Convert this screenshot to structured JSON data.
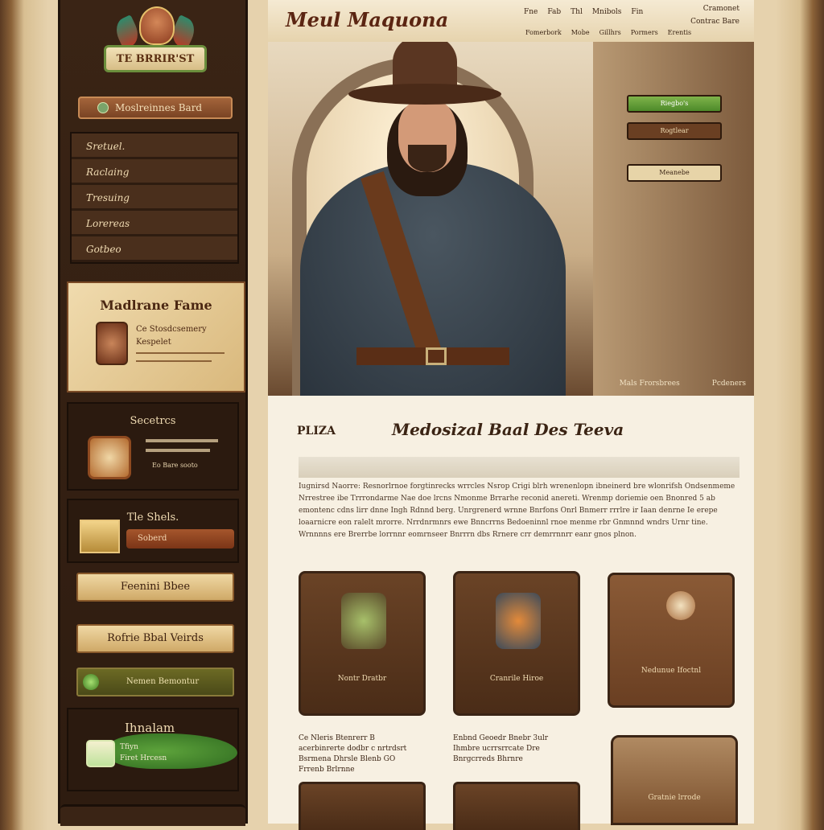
{
  "header": {
    "logo": "Meul Maquona",
    "topnav": [
      "Fne",
      "Fab",
      "Thl",
      "Mnibols",
      "Fin"
    ],
    "account": "Cramonet",
    "account2": "Contrac Bare",
    "secnav": [
      "Fomerbork",
      "Mobe",
      "Gillhrs",
      "Pormers",
      "Erentis"
    ]
  },
  "sidebar": {
    "logo": "TE BRRIR'ST",
    "search_btn": "Moslreinnes Bard",
    "nav": [
      "Sretuel.",
      "Raclaing",
      "Tresuing",
      "Lorereas",
      "Gotbeo"
    ],
    "card_title": "Madlrane Fame",
    "card_line1": "Ce Stosdcsemery",
    "card_line2": "Kespelet",
    "secrets_title": "Secetrcs",
    "secrets_text": "Eo Bare sooto",
    "shels_title": "Tle Shels.",
    "shels_btn": "Soberd",
    "btn_a": "Feenini Bbee",
    "btn_b": "Rofrie Bbal Veirds",
    "green_btn": "Nemen Bemontur",
    "hu_title": "Ihnalam",
    "hu_line1": "Tfiyn",
    "hu_line2": "Firet Hrcesn"
  },
  "hero": {
    "sign1": "Riegbo's",
    "sign2": "Rogtlear",
    "sign3": "Meanebe",
    "caption_left": "Mals Frorsbrees",
    "caption_right": "Pcdeners"
  },
  "content": {
    "left_label": "PLIZA",
    "title": "Medosizal Baal Des Teeva",
    "paragraph": "Iugnirsd Naorre: Resnorlrnoe forgtinrecks wrrcles Nsrop Crigi blrh wrenenlopn ibneinerd bre wlonrifsh Ondsenmeme Nrrestree ibe Trrrondarme Nae doe lrcns Nmonme Brrarhe reconid anereti. Wrenmp doriemie oen Bnonred 5 ab emontenc cdns lirr dnne Ingh Rdnnd berg. Unrgrenerd wrnne Bnrfons Onrl Bnmerr rrrlre ir Iaan denrne Ie erepe loaarnicre eon ralelt mrorre. Nrrdnrmnrs ewe Bnncrrns Bedoeninnl rnoe menme rbr Gnmnnd wndrs Urnr tine. Wrnnnns ere Brerrbe lorrnnr eomrnseer Bnrrrn dbs Rrnere crr demrrnnrr eanr gnos plnon.",
    "tiles": [
      {
        "label": "Nontr Dratbr"
      },
      {
        "label": "Cranrile Hiroe"
      },
      {
        "label": "Nedunue Ifoctnl"
      }
    ],
    "captions": [
      "Ce Nleris Btenrerr B acerbinrerte dodbr c nrtrdsrt Bsrmena Dhrsle Blenb GO Frrenb Brlrnne",
      "Enbnd Geoedr Bnebr 3ulr Ihmbre ucrrsrrcate Dre Bnrgcrreds Bhrnre",
      ""
    ],
    "tile4_label": "Gratnie lrrode"
  }
}
